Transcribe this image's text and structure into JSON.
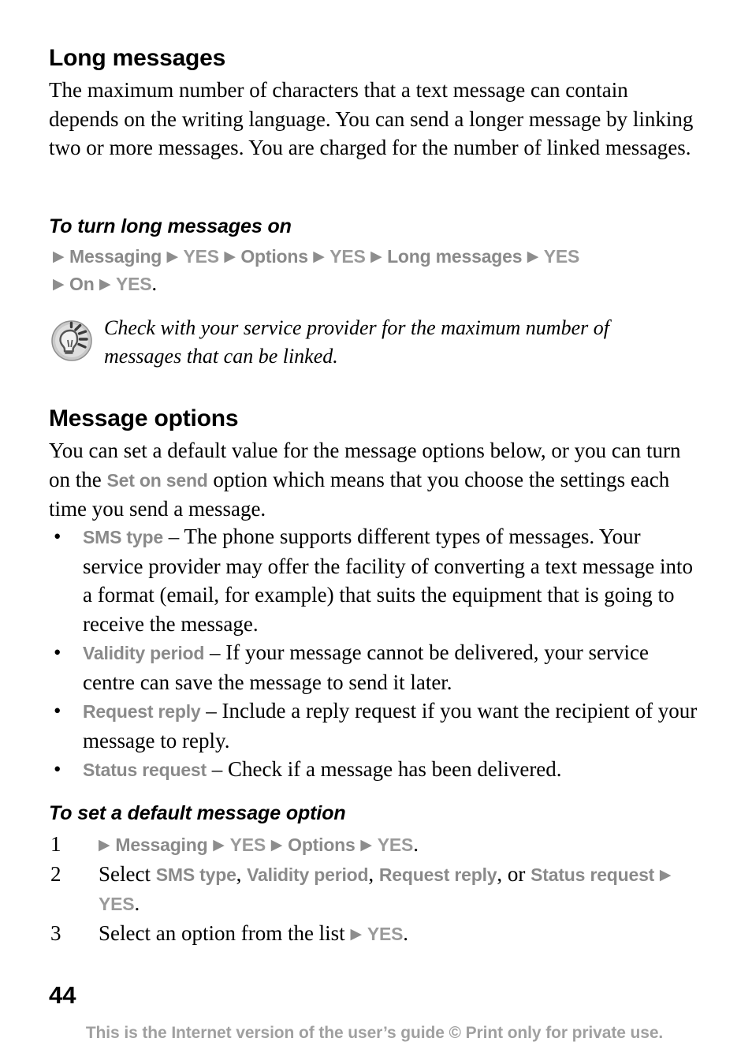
{
  "page": {
    "number": "44",
    "footer_note": "This is the Internet version of the user’s guide © Print only for private use.",
    "colors": {
      "ui_term_gray": "#8a8a8a",
      "ui_soft_gray": "#9a9a9a",
      "footer_gray": "#a0a0a0",
      "text_black": "#000000",
      "background": "#ffffff"
    }
  },
  "sections": {
    "long_messages": {
      "heading": "Long messages",
      "paragraph": "The maximum number of characters that a text message can contain depends on the writing language. You can send a longer message by linking two or more messages. You are charged for the number of linked messages."
    },
    "turn_long_messages_on": {
      "heading": "To turn long messages on",
      "nav": {
        "arrow": "▶",
        "item1": "Messaging",
        "item2": "YES",
        "item3": "Options",
        "item4": "YES",
        "item5": "Long messages",
        "item6": "YES",
        "item7": "On",
        "item8": "YES",
        "period": "."
      }
    },
    "tip": {
      "icon": "lightbulb-tip-icon",
      "text": "Check with your service provider for the maximum number of messages that can be linked."
    },
    "message_options": {
      "heading": "Message options",
      "intro_part1": "You can set a default value for the message options below, or you can turn on the ",
      "intro_term": "Set on send",
      "intro_part2": " option which means that you choose the settings each time you send a message.",
      "bullet_char": "•",
      "dash": "–",
      "bullets": [
        {
          "term": "SMS type",
          "text": "The phone supports different types of messages. Your service provider may offer the facility of converting a text message into a format (email, for example) that suits the equipment that is going to receive the message."
        },
        {
          "term": "Validity period",
          "text": "If your message cannot be delivered, your service centre can save the message to send it later."
        },
        {
          "term": "Request reply",
          "text": "Include a reply request if you want the recipient of your message to reply."
        },
        {
          "term": "Status request",
          "text": "Check if a message has been delivered."
        }
      ]
    },
    "set_default_option": {
      "heading": "To set a default message option",
      "steps": [
        {
          "num": "1",
          "nav": {
            "arrow": "▶",
            "item1": "Messaging",
            "item2": "YES",
            "item3": "Options",
            "item4": "YES",
            "period": "."
          }
        },
        {
          "num": "2",
          "lead": "Select ",
          "opt1": "SMS type",
          "sep1": ", ",
          "opt2": "Validity period",
          "sep2": ", ",
          "opt3": "Request reply",
          "sep3": ", or",
          "opt4": "Status request",
          "arrow": "▶",
          "confirm": "YES",
          "period": "."
        },
        {
          "num": "3",
          "lead": "Select an option from the list ",
          "arrow": "▶",
          "confirm": "YES",
          "period": "."
        }
      ]
    }
  }
}
